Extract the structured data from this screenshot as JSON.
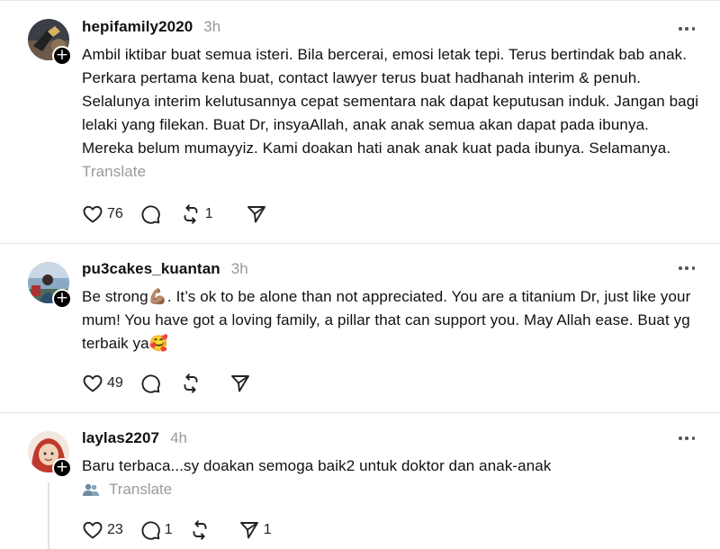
{
  "posts": [
    {
      "username": "hepifamily2020",
      "time": "3h",
      "text": "Ambil iktibar buat semua isteri. Bila bercerai, emosi letak tepi. Terus bertindak bab anak. Perkara pertama kena buat, contact lawyer terus buat hadhanah interim & penuh. Selalunya interim kelutusannya cepat sementara nak dapat keputusan induk. Jangan bagi lelaki yang filekan. Buat Dr, insyaAllah, anak anak semua akan dapat pada ibunya. Mereka belum mumayyiz. Kami doakan hati anak anak kuat pada ibunya. Selamanya.",
      "translate": "Translate",
      "likes": "76",
      "replies": "",
      "reposts": "1",
      "shares": ""
    },
    {
      "username": "pu3cakes_kuantan",
      "time": "3h",
      "text": "Be strong💪🏽. It’s ok to be alone than not appreciated. You are a titanium Dr, just like your mum! You have got a loving family, a pillar that can support you. May Allah ease. Buat yg terbaik ya🥰",
      "likes": "49",
      "replies": "",
      "reposts": "",
      "shares": ""
    },
    {
      "username": "laylas2207",
      "time": "4h",
      "text": "Baru terbaca...sy doakan semoga baik2 untuk doktor dan anak-anak",
      "translate": "Translate",
      "likes": "23",
      "replies": "1",
      "reposts": "",
      "shares": "1"
    }
  ],
  "icons": {
    "like": "heart-icon",
    "reply": "comment-icon",
    "repost": "repost-icon",
    "share": "send-icon",
    "more": "more-horizontal-icon",
    "follow": "plus-icon",
    "translate": "people-icon"
  },
  "colors": {
    "text": "#111111",
    "muted": "#999999",
    "separator": "#e3e3e3"
  }
}
